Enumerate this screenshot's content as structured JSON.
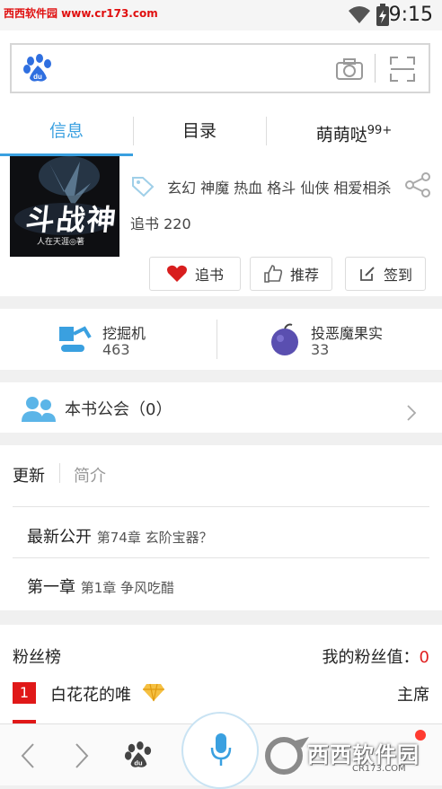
{
  "status": {
    "watermark": "西西软件园 www.cr173.com",
    "time": "9:15"
  },
  "search": {
    "placeholder": ""
  },
  "tabs": [
    {
      "label": "信息"
    },
    {
      "label": "目录"
    },
    {
      "label": "萌萌哒",
      "badge": "99+"
    }
  ],
  "book": {
    "cover_title": "斗战神",
    "cover_author": "人在天涯◎著",
    "tags": "玄幻 神魔 热血 格斗 仙侠 相爱相杀",
    "followers_label": "追书 220",
    "actions": [
      {
        "label": "追书"
      },
      {
        "label": "推荐"
      },
      {
        "label": "签到"
      }
    ]
  },
  "stats": [
    {
      "label": "挖掘机",
      "value": "463"
    },
    {
      "label": "投恶魔果实",
      "value": "33"
    }
  ],
  "guild": {
    "label": "本书公会（0）"
  },
  "updates": {
    "tabs": [
      "更新",
      "简介"
    ],
    "rows": [
      {
        "label": "最新公开",
        "chapter": "第74章 玄阶宝器？"
      },
      {
        "label": "第一章",
        "chapter": "第1章 争风吃醋"
      }
    ]
  },
  "fans": {
    "title": "粉丝榜",
    "my_value_label": "我的粉丝值：",
    "my_value": "0",
    "entries": [
      {
        "rank": "1",
        "name": "白花花的唯",
        "role": "主席"
      }
    ]
  },
  "footer_watermark": "西西软件园",
  "footer_watermark_url": "CR173.COM",
  "colors": {
    "accent": "#3aa0e0",
    "red": "#e02020"
  }
}
